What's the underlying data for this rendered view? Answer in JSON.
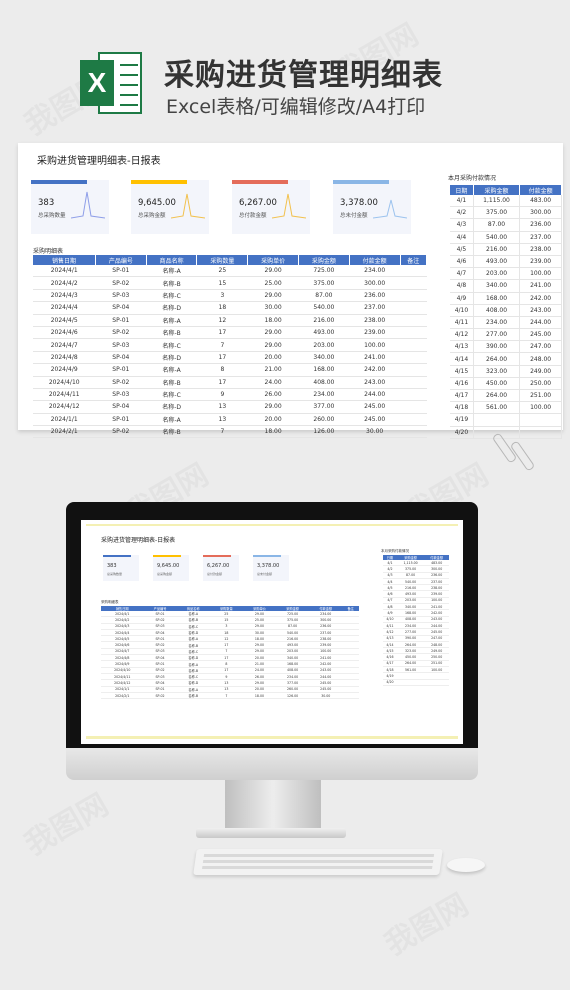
{
  "banner": {
    "logo_letter": "X",
    "title": "采购进货管理明细表",
    "subtitle": "Excel表格/可编辑修改/A4打印"
  },
  "sheet": {
    "title": "采购进货管理明细表-日报表",
    "cards": [
      {
        "value": "383",
        "label": "总采购数量",
        "color": "#4472c4"
      },
      {
        "value": "9,645.00",
        "label": "总采购金额",
        "color": "#ffc000"
      },
      {
        "value": "6,267.00",
        "label": "总付款金额",
        "color": "#e46c5a"
      },
      {
        "value": "3,378.00",
        "label": "总未付金额",
        "color": "#8ab6e6"
      }
    ],
    "section_label": "采购明细表",
    "columns": [
      "销售日期",
      "产品编号",
      "商品名称",
      "采购数量",
      "采购单价",
      "采购金额",
      "付款金额",
      "备注"
    ],
    "rows": [
      [
        "2024/4/1",
        "SP-01",
        "名称-A",
        "25",
        "29.00",
        "725.00",
        "234.00",
        ""
      ],
      [
        "2024/4/2",
        "SP-02",
        "名称-B",
        "15",
        "25.00",
        "375.00",
        "300.00",
        ""
      ],
      [
        "2024/4/3",
        "SP-03",
        "名称-C",
        "3",
        "29.00",
        "87.00",
        "236.00",
        ""
      ],
      [
        "2024/4/4",
        "SP-04",
        "名称-D",
        "18",
        "30.00",
        "540.00",
        "237.00",
        ""
      ],
      [
        "2024/4/5",
        "SP-01",
        "名称-A",
        "12",
        "18.00",
        "216.00",
        "238.00",
        ""
      ],
      [
        "2024/4/6",
        "SP-02",
        "名称-B",
        "17",
        "29.00",
        "493.00",
        "239.00",
        ""
      ],
      [
        "2024/4/7",
        "SP-03",
        "名称-C",
        "7",
        "29.00",
        "203.00",
        "100.00",
        ""
      ],
      [
        "2024/4/8",
        "SP-04",
        "名称-D",
        "17",
        "20.00",
        "340.00",
        "241.00",
        ""
      ],
      [
        "2024/4/9",
        "SP-01",
        "名称-A",
        "8",
        "21.00",
        "168.00",
        "242.00",
        ""
      ],
      [
        "2024/4/10",
        "SP-02",
        "名称-B",
        "17",
        "24.00",
        "408.00",
        "243.00",
        ""
      ],
      [
        "2024/4/11",
        "SP-03",
        "名称-C",
        "9",
        "26.00",
        "234.00",
        "244.00",
        ""
      ],
      [
        "2024/4/12",
        "SP-04",
        "名称-D",
        "13",
        "29.00",
        "377.00",
        "245.00",
        ""
      ],
      [
        "2024/1/1",
        "SP-01",
        "名称-A",
        "13",
        "20.00",
        "260.00",
        "245.00",
        ""
      ],
      [
        "2024/2/1",
        "SP-02",
        "名称-B",
        "7",
        "18.00",
        "126.00",
        "30.00",
        ""
      ]
    ],
    "side_title": "本月采购付款情况",
    "side_columns": [
      "日期",
      "采购金额",
      "付款金额"
    ],
    "side_rows": [
      [
        "4/1",
        "1,115.00",
        "483.00"
      ],
      [
        "4/2",
        "375.00",
        "300.00"
      ],
      [
        "4/3",
        "87.00",
        "236.00"
      ],
      [
        "4/4",
        "540.00",
        "237.00"
      ],
      [
        "4/5",
        "216.00",
        "238.00"
      ],
      [
        "4/6",
        "493.00",
        "239.00"
      ],
      [
        "4/7",
        "203.00",
        "100.00"
      ],
      [
        "4/8",
        "340.00",
        "241.00"
      ],
      [
        "4/9",
        "168.00",
        "242.00"
      ],
      [
        "4/10",
        "408.00",
        "243.00"
      ],
      [
        "4/11",
        "234.00",
        "244.00"
      ],
      [
        "4/12",
        "277.00",
        "245.00"
      ],
      [
        "4/13",
        "390.00",
        "247.00"
      ],
      [
        "4/14",
        "264.00",
        "248.00"
      ],
      [
        "4/15",
        "323.00",
        "249.00"
      ],
      [
        "4/16",
        "450.00",
        "250.00"
      ],
      [
        "4/17",
        "264.00",
        "251.00"
      ],
      [
        "4/18",
        "561.00",
        "100.00"
      ],
      [
        "4/19",
        "",
        ""
      ],
      [
        "4/20",
        "",
        ""
      ]
    ]
  },
  "watermark": "我图网"
}
